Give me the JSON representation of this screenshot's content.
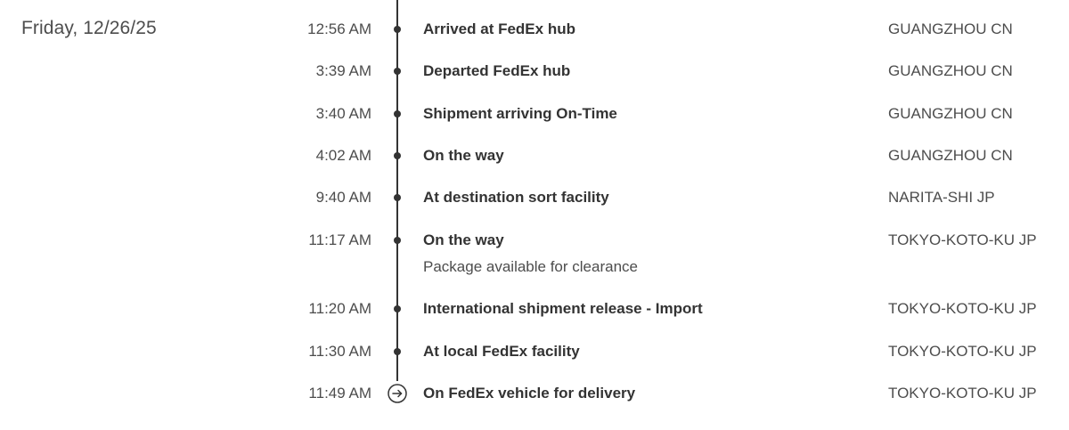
{
  "date": "Friday, 12/26/25",
  "events": [
    {
      "time": "12:56 AM",
      "status": "Arrived at FedEx hub",
      "detail": "",
      "location": "GUANGZHOU CN"
    },
    {
      "time": "3:39 AM",
      "status": "Departed FedEx hub",
      "detail": "",
      "location": "GUANGZHOU CN"
    },
    {
      "time": "3:40 AM",
      "status": "Shipment arriving On-Time",
      "detail": "",
      "location": "GUANGZHOU CN"
    },
    {
      "time": "4:02 AM",
      "status": "On the way",
      "detail": "",
      "location": "GUANGZHOU CN"
    },
    {
      "time": "9:40 AM",
      "status": "At destination sort facility",
      "detail": "",
      "location": "NARITA-SHI JP"
    },
    {
      "time": "11:17 AM",
      "status": "On the way",
      "detail": "Package available for clearance",
      "location": "TOKYO-KOTO-KU JP"
    },
    {
      "time": "11:20 AM",
      "status": "International shipment release - Import",
      "detail": "",
      "location": "TOKYO-KOTO-KU JP"
    },
    {
      "time": "11:30 AM",
      "status": "At local FedEx facility",
      "detail": "",
      "location": "TOKYO-KOTO-KU JP"
    },
    {
      "time": "11:49 AM",
      "status": "On FedEx vehicle for delivery",
      "detail": "",
      "location": "TOKYO-KOTO-KU JP"
    }
  ],
  "icons": {
    "event_marker": "timeline-dot-icon",
    "current_marker": "arrow-right-circle-icon"
  },
  "colors": {
    "text": "#333333",
    "muted": "#4d4d4d",
    "line": "#333333"
  }
}
